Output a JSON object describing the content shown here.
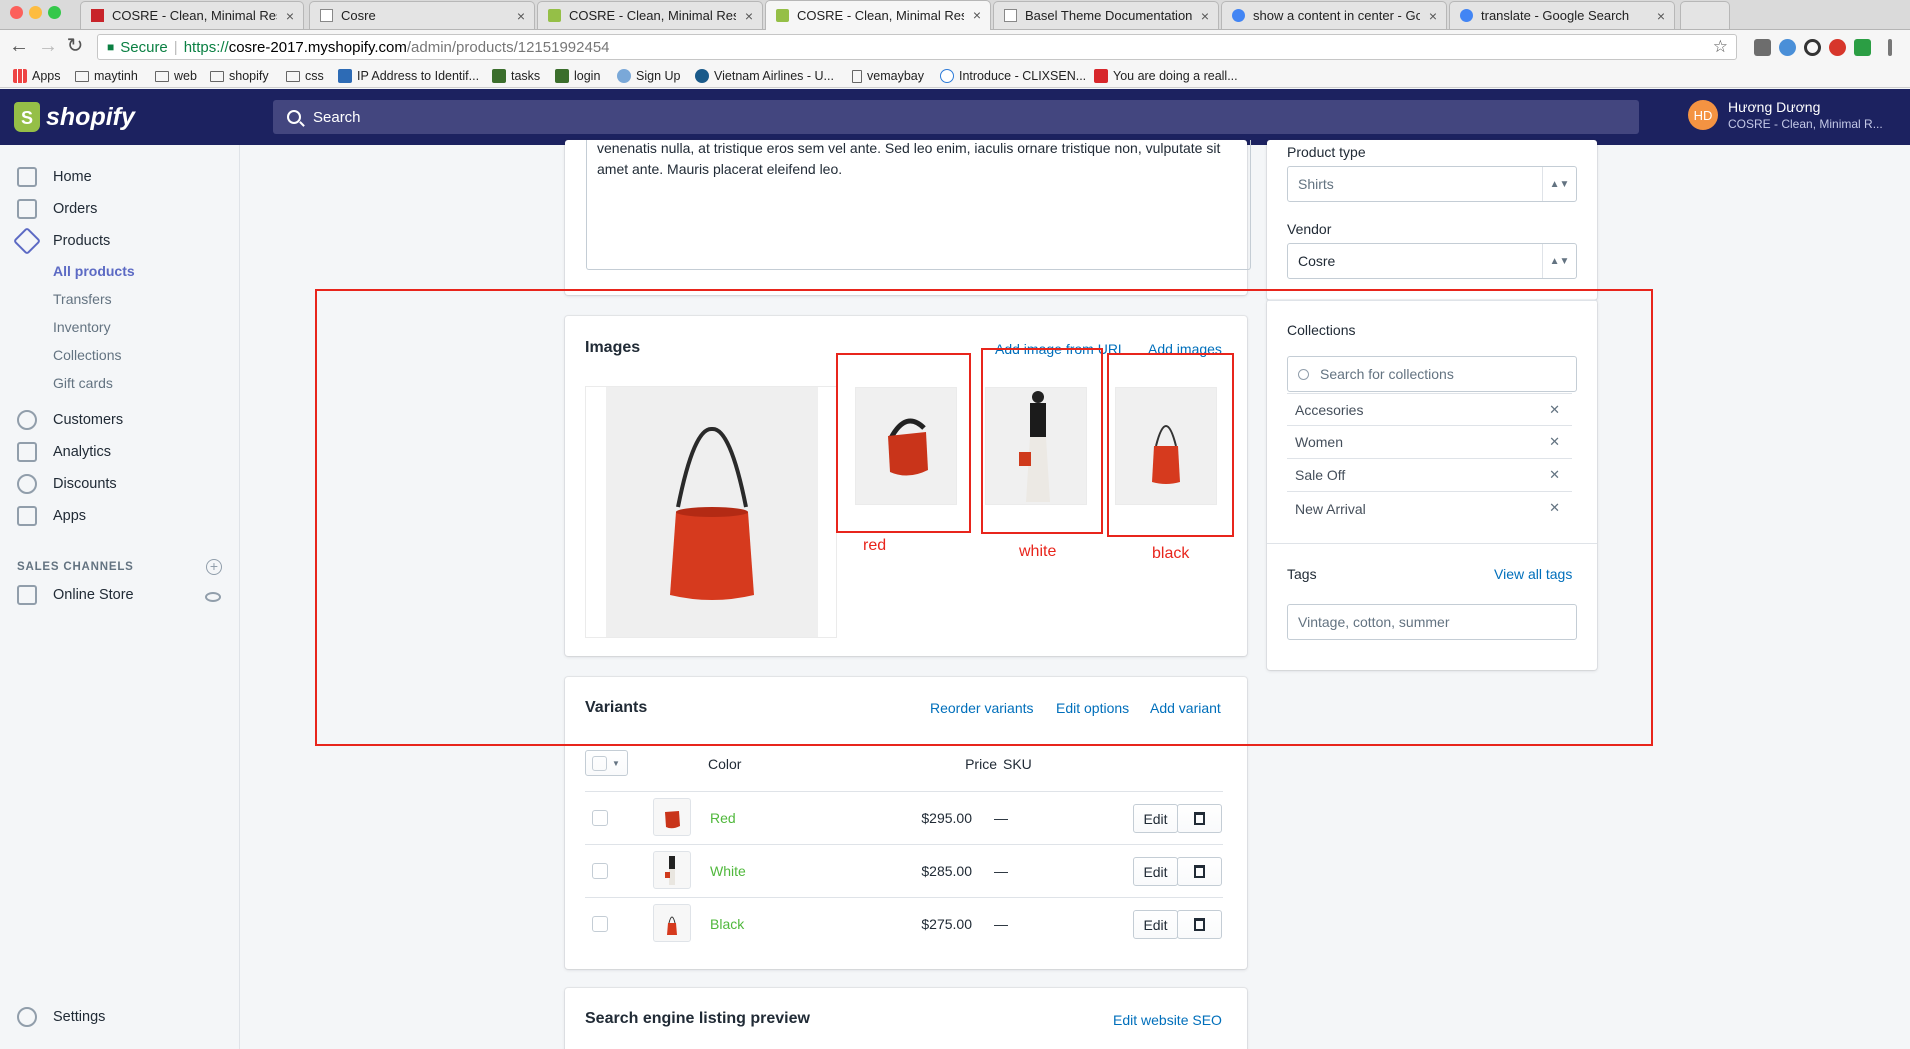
{
  "browser": {
    "tabs": [
      {
        "label": "COSRE - Clean, Minimal Respo",
        "favicon_color": "#c8242a"
      },
      {
        "label": "Cosre",
        "favicon_color": "#9a9a9a"
      },
      {
        "label": "COSRE - Clean, Minimal Respo",
        "favicon_color": "#95bf47"
      },
      {
        "label": "COSRE - Clean, Minimal Respo",
        "favicon_color": "#95bf47",
        "active": true
      },
      {
        "label": "Basel Theme Documentation",
        "favicon_color": "#9a9a9a"
      },
      {
        "label": "show a content in center - Goo",
        "favicon_color": "#4285f4"
      },
      {
        "label": "translate - Google Search",
        "favicon_color": "#4285f4"
      }
    ],
    "tab_close": "×",
    "nav": {
      "back": "←",
      "forward": "→",
      "reload": "↻"
    },
    "address": {
      "secure_label": "Secure",
      "scheme": "https://",
      "host": "cosre-2017.myshopify.com",
      "path": "/admin/products/12151992454"
    },
    "star": "☆",
    "bookmarks": [
      {
        "label": "Apps",
        "icon": "apps-grid-icon"
      },
      {
        "label": "maytinh",
        "icon": "folder-icon"
      },
      {
        "label": "web",
        "icon": "folder-icon"
      },
      {
        "label": "shopify",
        "icon": "folder-icon"
      },
      {
        "label": "css",
        "icon": "folder-icon"
      },
      {
        "label": "IP Address to Identif...",
        "icon": "ip-icon"
      },
      {
        "label": "tasks",
        "icon": "tasks-icon"
      },
      {
        "label": "login",
        "icon": "login-icon"
      },
      {
        "label": "Sign Up",
        "icon": "cloud-icon"
      },
      {
        "label": "Vietnam Airlines - U...",
        "icon": "airline-icon"
      },
      {
        "label": "vemaybay",
        "icon": "page-icon"
      },
      {
        "label": "Introduce - CLIXSEN...",
        "icon": "clixsense-icon"
      },
      {
        "label": "You are doing a reall...",
        "icon": "flag-icon"
      }
    ]
  },
  "topbar": {
    "logo_text": "shopify",
    "search_placeholder": "Search",
    "user": {
      "initials": "HD",
      "name": "Hương Dương",
      "store": "COSRE - Clean, Minimal R..."
    }
  },
  "sidebar": {
    "items": [
      {
        "label": "Home",
        "icon": "home-icon"
      },
      {
        "label": "Orders",
        "icon": "orders-icon"
      },
      {
        "label": "Products",
        "icon": "tag-icon"
      },
      {
        "label": "Customers",
        "icon": "customers-icon"
      },
      {
        "label": "Analytics",
        "icon": "analytics-icon"
      },
      {
        "label": "Discounts",
        "icon": "discounts-icon"
      },
      {
        "label": "Apps",
        "icon": "apps-icon"
      }
    ],
    "product_subitems": [
      "All products",
      "Transfers",
      "Inventory",
      "Collections",
      "Gift cards"
    ],
    "sales_channels_heading": "SALES CHANNELS",
    "online_store": "Online Store",
    "settings": "Settings",
    "add_symbol": "+"
  },
  "description": {
    "text": "venenatis nulla, at tristique eros sem vel ante. Sed leo enim, iaculis ornare tristique non, vulputate sit amet ante. Mauris placerat eleifend leo."
  },
  "images_card": {
    "title": "Images",
    "add_from_url": "Add image from URL",
    "add_images": "Add images",
    "annotations": [
      "red",
      "white",
      "black"
    ]
  },
  "variants_card": {
    "title": "Variants",
    "reorder": "Reorder variants",
    "edit_options": "Edit options",
    "add_variant": "Add variant",
    "columns": {
      "color": "Color",
      "price": "Price",
      "sku": "SKU"
    },
    "rows": [
      {
        "color": "Red",
        "price": "$295.00",
        "sku": "—",
        "edit": "Edit"
      },
      {
        "color": "White",
        "price": "$285.00",
        "sku": "—",
        "edit": "Edit"
      },
      {
        "color": "Black",
        "price": "$275.00",
        "sku": "—",
        "edit": "Edit"
      }
    ]
  },
  "seo_card": {
    "title": "Search engine listing preview",
    "edit": "Edit website SEO"
  },
  "organization": {
    "product_type_label": "Product type",
    "product_type_value": "Shirts",
    "vendor_label": "Vendor",
    "vendor_value": "Cosre",
    "select_arrows": "▲▼",
    "collections_label": "Collections",
    "collections_search_placeholder": "Search for collections",
    "collections": [
      "Accesories",
      "Women",
      "Sale Off",
      "New Arrival"
    ],
    "remove_symbol": "✕",
    "tags_label": "Tags",
    "view_all_tags": "View all tags",
    "tags_placeholder": "Vintage, cotton, summer"
  },
  "colors": {
    "annotation": "#e8251c",
    "link": "#006fbb",
    "variant_link": "#50b83c",
    "topbar": "#1c2260",
    "accent": "#5c6ac4"
  }
}
